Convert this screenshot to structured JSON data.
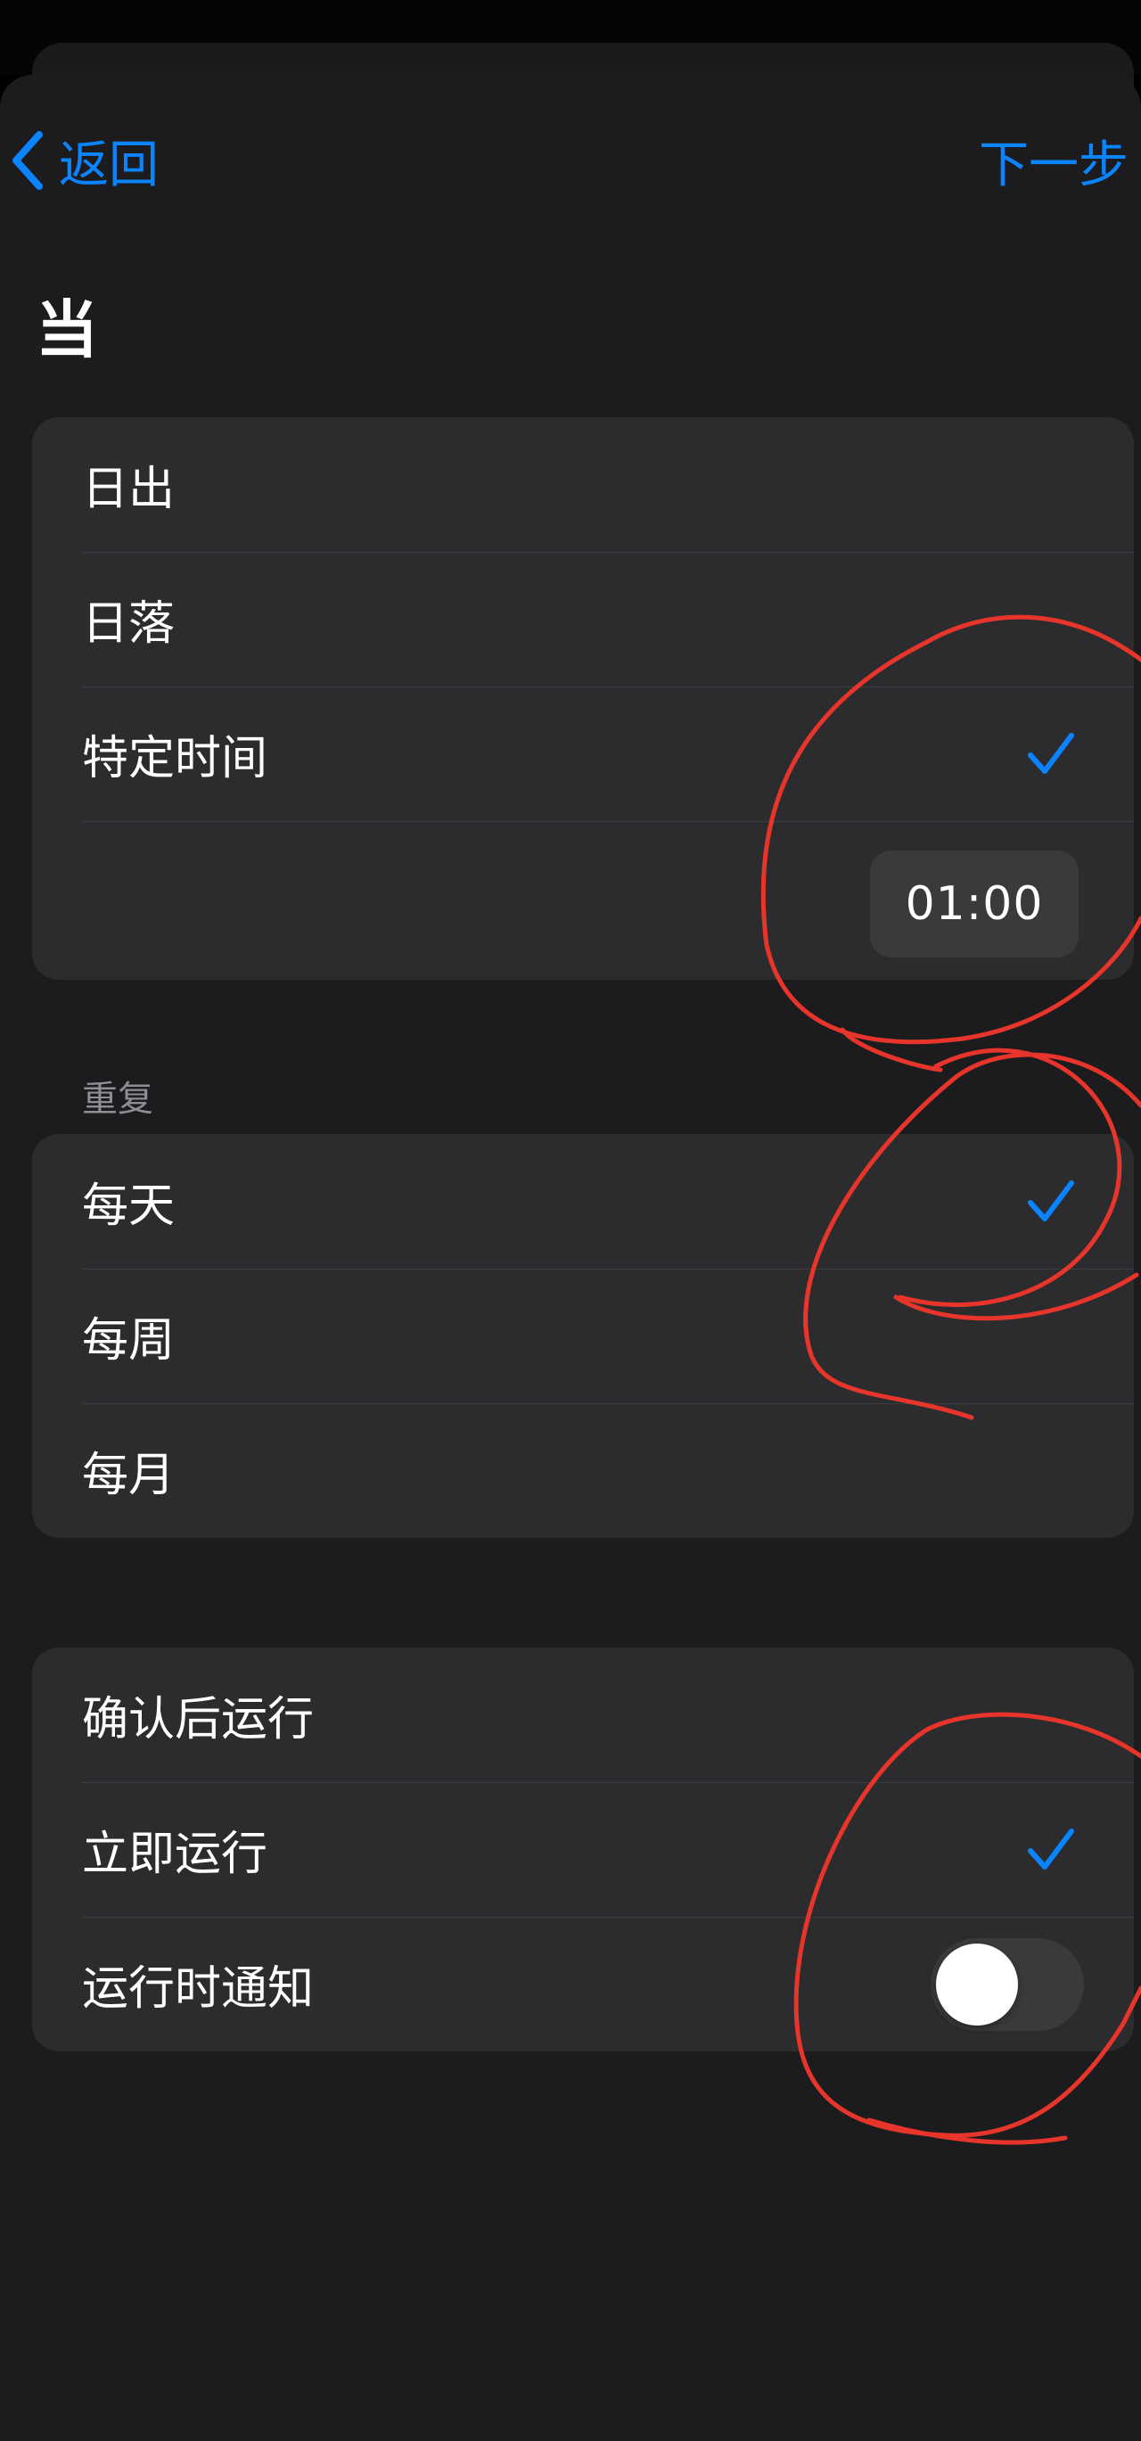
{
  "nav": {
    "back_label": "返回",
    "next_label": "下一步"
  },
  "title": "当",
  "time_options": {
    "items": [
      {
        "label": "日出",
        "selected": false
      },
      {
        "label": "日落",
        "selected": false
      },
      {
        "label": "特定时间",
        "selected": true
      }
    ],
    "time_value": "01:00"
  },
  "repeat": {
    "section_label": "重复",
    "items": [
      {
        "label": "每天",
        "selected": true
      },
      {
        "label": "每周",
        "selected": false
      },
      {
        "label": "每月",
        "selected": false
      }
    ]
  },
  "run": {
    "items": [
      {
        "label": "确认后运行",
        "selected": false
      },
      {
        "label": "立即运行",
        "selected": true
      }
    ],
    "notify_label": "运行时通知",
    "notify_on": false
  },
  "colors": {
    "accent": "#0a84ff",
    "annotation": "#e8352b",
    "background": "#1c1c1e",
    "cell": "#2c2c2e"
  },
  "icons": {
    "back": "chevron-left-icon",
    "check": "checkmark-icon"
  }
}
